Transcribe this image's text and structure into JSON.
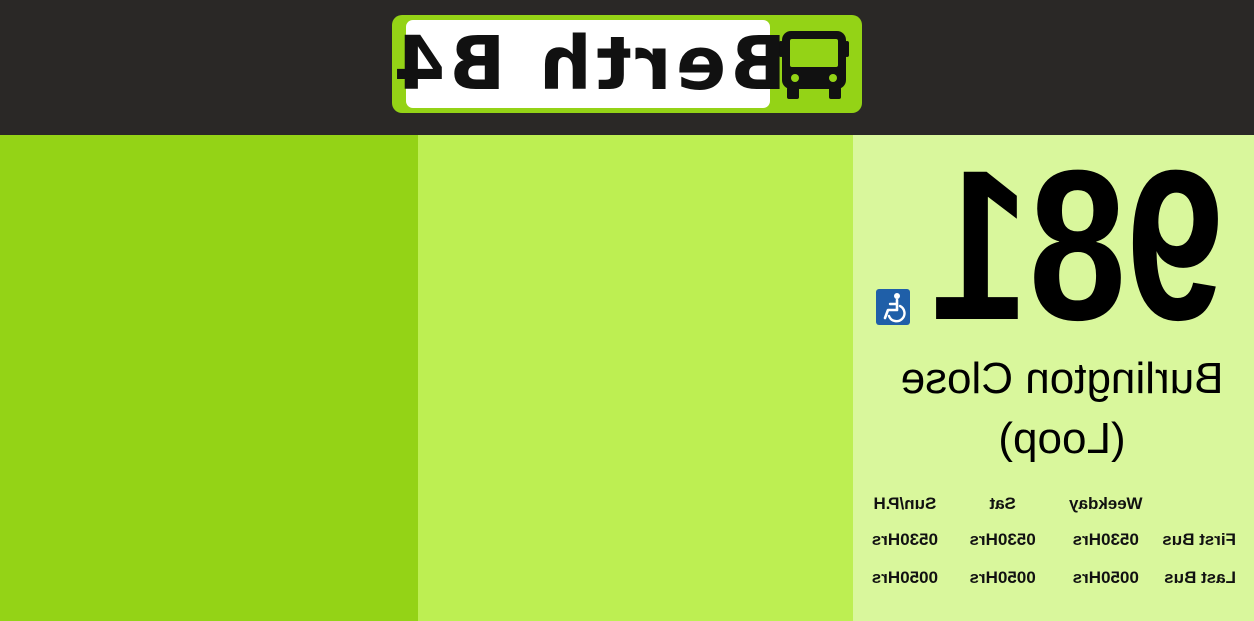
{
  "berth": {
    "label": "Berth B4",
    "icon": "bus-icon"
  },
  "route": {
    "number": "981",
    "accessibility_icon": "wheelchair-icon",
    "destination_line1": "Burlington Close",
    "destination_line2": "(Loop)"
  },
  "timetable": {
    "columns": [
      "Weekday",
      "Sat",
      "Sun/P.H"
    ],
    "rows": [
      {
        "label": "First Bus",
        "values": [
          "0530Hrs",
          "0530Hrs",
          "0530Hrs"
        ]
      },
      {
        "label": "Last Bus",
        "values": [
          "0050Hrs",
          "0050Hrs",
          "0050Hrs"
        ]
      }
    ]
  },
  "colors": {
    "header_bg": "#2a2826",
    "brand_green": "#94d316",
    "panel_mid": "#bdef52",
    "panel_light": "#d9f79c",
    "accessibility_blue": "#1f5fa8"
  }
}
